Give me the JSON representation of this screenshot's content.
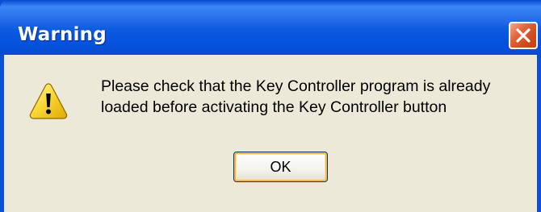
{
  "window": {
    "title": "Warning",
    "close_icon": "close-icon"
  },
  "dialog": {
    "icon": "warning-icon",
    "message_line1": "Please check that the Key Controller program is already",
    "message_line2": "loaded before activating the Key Controller button",
    "ok_label": "OK"
  },
  "colors": {
    "titlebar": "#0a55dd",
    "client": "#ece9d8",
    "close_button": "#e0562b"
  }
}
